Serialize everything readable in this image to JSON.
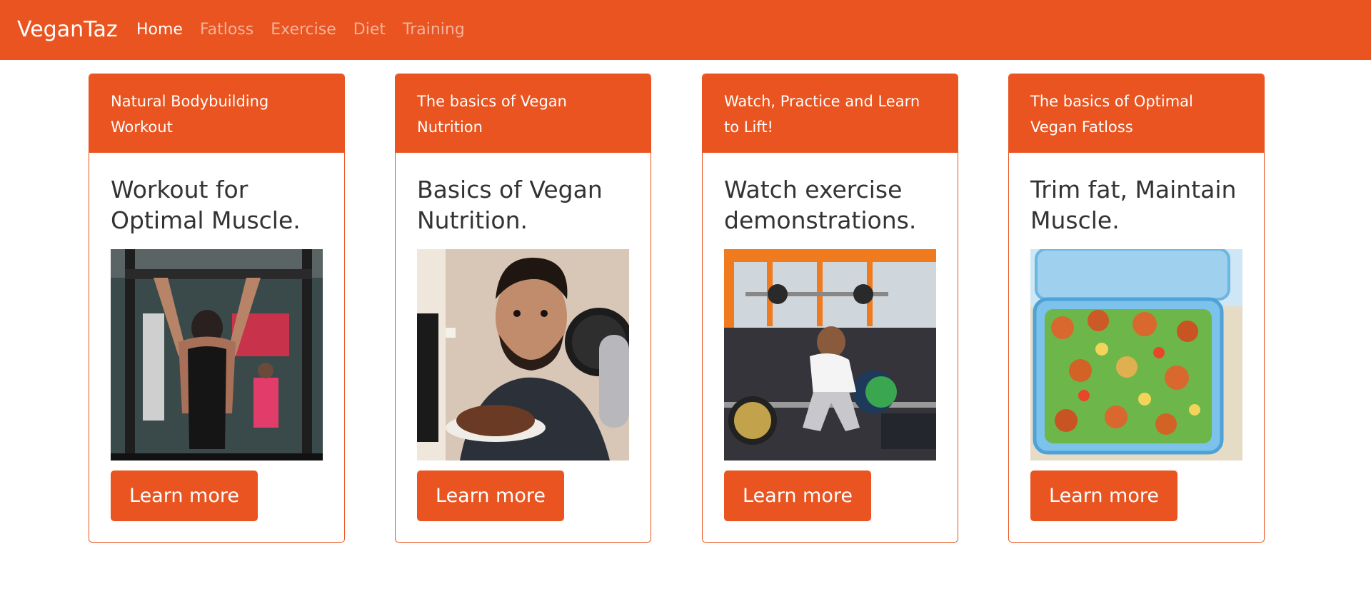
{
  "navbar": {
    "brand": "VeganTaz",
    "links": [
      "Home",
      "Fatloss",
      "Exercise",
      "Diet",
      "Training"
    ],
    "active": "Home",
    "color": "#e95420"
  },
  "cards": [
    {
      "header": "Natural Bodybuilding Workout",
      "title": "Workout for Optimal Muscle.",
      "image": "man-doing-pullups-photo",
      "button": "Learn more"
    },
    {
      "header": "The basics of Vegan Nutrition",
      "title": "Basics of Vegan Nutrition.",
      "image": "man-with-plate-and-microphone-photo",
      "button": "Learn more"
    },
    {
      "header": "Watch, Practice and Learn to Lift!",
      "title": "Watch exercise demonstrations.",
      "image": "man-deadlifting-in-gym-photo",
      "button": "Learn more"
    },
    {
      "header": "The basics of Optimal Vegan Fatloss",
      "title": "Trim fat, Maintain Muscle.",
      "image": "vegan-meal-prep-box-photo",
      "button": "Learn more"
    }
  ]
}
